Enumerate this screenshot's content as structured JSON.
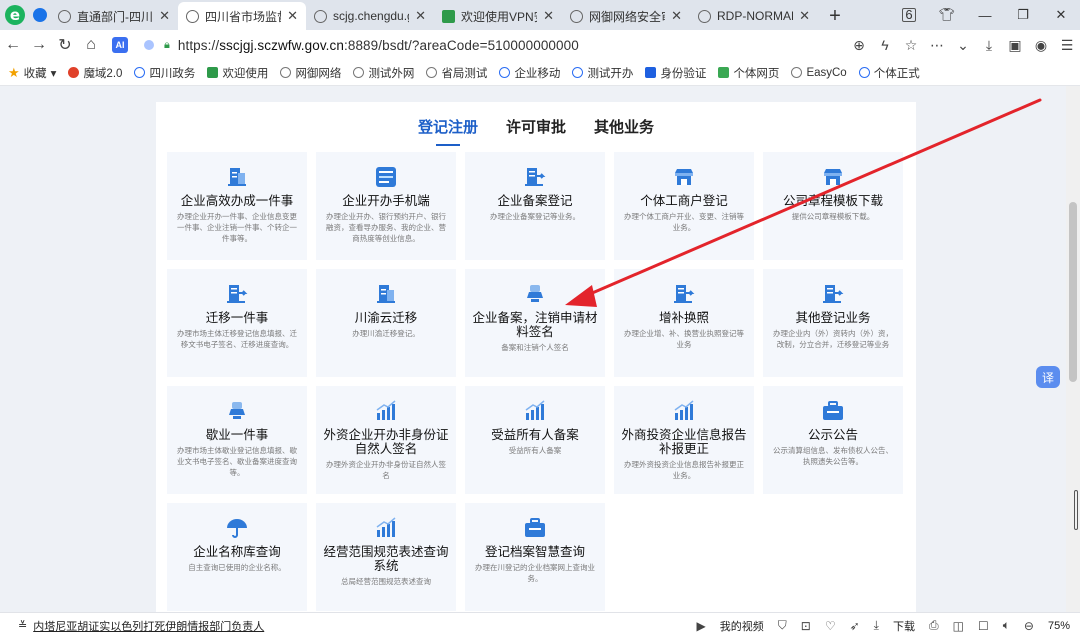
{
  "tabs": [
    {
      "title": "直通部门-四川政",
      "active": false
    },
    {
      "title": "四川省市场监督",
      "active": true
    },
    {
      "title": "scjg.chengdu.g",
      "active": false
    },
    {
      "title": "欢迎使用VPN安",
      "active": false
    },
    {
      "title": "网御网络安全审",
      "active": false
    },
    {
      "title": "RDP-NORMAL-",
      "active": false
    }
  ],
  "tab_count": "6",
  "address": {
    "url_prefix": "https://",
    "url_host": "sscjgj.sczwfw.gov.cn",
    "url_rest": ":8889/bsdt/?areaCode=510000000000"
  },
  "bookmarks": [
    "收藏",
    "魔域2.0",
    "四川政务",
    "欢迎使用",
    "网御网络",
    "测试外网",
    "省局测试",
    "企业移动",
    "测试开办",
    "身份验证",
    "个体网页",
    "EasyCo",
    "个体正式"
  ],
  "categories": [
    {
      "label": "登记注册",
      "active": true
    },
    {
      "label": "许可审批",
      "active": false
    },
    {
      "label": "其他业务",
      "active": false
    }
  ],
  "services": [
    {
      "name": "企业高效办成一件事",
      "desc": "办理企业开办一件事、企业信息变更一件事、企业注销一件事、个转企一件事等。",
      "icon": "doc-blue-icon"
    },
    {
      "name": "企业开办手机端",
      "desc": "办理企业开办、银行预约开户、银行融资，查看导办服务、我的企业、营商热度等创业信息。",
      "icon": "qr-app-icon"
    },
    {
      "name": "企业备案登记",
      "desc": "办理企业备案登记等业务。",
      "icon": "doc-transfer-icon"
    },
    {
      "name": "个体工商户登记",
      "desc": "办理个体工商户开业、变更、注销等业务。",
      "icon": "shop-icon"
    },
    {
      "name": "公司章程模板下载",
      "desc": "提供公司章程模板下载。",
      "icon": "shop-icon"
    },
    {
      "name": "迁移一件事",
      "desc": "办理市场主体迁移登记信息填报、迁移文书电子签名、迁移进度查询。",
      "icon": "doc-transfer-icon"
    },
    {
      "name": "川渝云迁移",
      "desc": "办理川渝迁移登记。",
      "icon": "doc-blue-icon"
    },
    {
      "name": "企业备案，注销申请材料签名",
      "desc": "备案和注销个人签名",
      "icon": "stamp-icon"
    },
    {
      "name": "增补换照",
      "desc": "办理企业增、补、换营业执照登记等业务",
      "icon": "doc-transfer-icon"
    },
    {
      "name": "其他登记业务",
      "desc": "办理企业内（外）资转内（外）资，改制，分立合并，迁移登记等业务",
      "icon": "doc-transfer-icon"
    },
    {
      "name": "歇业一件事",
      "desc": "办理市场主体歇业登记信息填报、歇业文书电子签名、歇业备案进度查询等。",
      "icon": "stamp-icon"
    },
    {
      "name": "外资企业开办非身份证自然人签名",
      "desc": "办理外资企业开办非身份证自然人签名",
      "icon": "chart-icon"
    },
    {
      "name": "受益所有人备案",
      "desc": "受益所有人备案",
      "icon": "chart-icon"
    },
    {
      "name": "外商投资企业信息报告补报更正",
      "desc": "办理外资投资企业信息报告补报更正业务。",
      "icon": "chart-icon"
    },
    {
      "name": "公示公告",
      "desc": "公示清算组信息、发布债权人公告、执照遗失公告等。",
      "icon": "briefcase-icon"
    },
    {
      "name": "企业名称库查询",
      "desc": "自主查询已使用的企业名称。",
      "icon": "umbrella-icon"
    },
    {
      "name": "经营范围规范表述查询系统",
      "desc": "总局经营范围规范表述查询",
      "icon": "chart-icon"
    },
    {
      "name": "登记档案智慧查询",
      "desc": "办理在川登记的企业档案网上查询业务。",
      "icon": "briefcase-icon"
    }
  ],
  "float_button": "译",
  "status": {
    "news": "内塔尼亚胡证实以色列打死伊朗情报部门负责人",
    "video": "我的视频",
    "download": "下载",
    "zoom": "75%"
  },
  "colors": {
    "accent": "#1d5fc8",
    "icon_blue": "#2f7ad8",
    "arrow": "#e3242b"
  }
}
